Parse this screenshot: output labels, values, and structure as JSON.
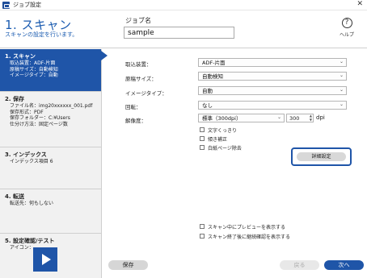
{
  "window": {
    "title": "ジョブ設定",
    "close": "✕"
  },
  "header": {
    "title": "1. スキャン",
    "subtitle": "スキャンの設定を行います。",
    "job_name_label": "ジョブ名",
    "job_name_value": "sample",
    "help_label": "ヘルプ",
    "help_icon": "?"
  },
  "sidebar": {
    "steps": [
      {
        "title": "1. スキャン",
        "lines": [
          "取込装置：ADF-片面",
          "原稿サイズ：自動検知",
          "イメージタイプ：自動"
        ]
      },
      {
        "title": "2. 保存",
        "lines": [
          "ファイル名：img20xxxxxx_001.pdf",
          "保存形式：PDF",
          "保存フォルダー：C:¥Users",
          "仕分け方法：固定ページ数"
        ]
      },
      {
        "title": "3. インデックス",
        "lines": [
          "インデックス項目 6"
        ]
      },
      {
        "title": "4. 転送",
        "lines": [
          "転送先：何もしない"
        ]
      },
      {
        "title": "5. 設定確認/テスト",
        "lines": [
          "アイコン："
        ]
      }
    ]
  },
  "form": {
    "source_label": "取込装置：",
    "source_value": "ADF-片面",
    "size_label": "原稿サイズ：",
    "size_value": "自動検知",
    "image_type_label": "イメージタイプ：",
    "image_type_value": "自動",
    "rotation_label": "回転：",
    "rotation_value": "なし",
    "resolution_label": "解像度：",
    "resolution_value": "標準（300dpi）",
    "dpi_value": "300",
    "dpi_unit": "dpi",
    "checkboxes": [
      "文字くっきり",
      "傾き補正",
      "白紙ページ除去"
    ],
    "advanced_button": "詳細設定",
    "preview_checkbox": "スキャン中にプレビューを表示する",
    "confirm_checkbox": "スキャン終了後に継続確認を表示する"
  },
  "footer": {
    "save": "保存",
    "back": "戻る",
    "next": "次へ"
  },
  "colors": {
    "accent": "#1f55a8",
    "title_blue": "#1a5bb0"
  }
}
